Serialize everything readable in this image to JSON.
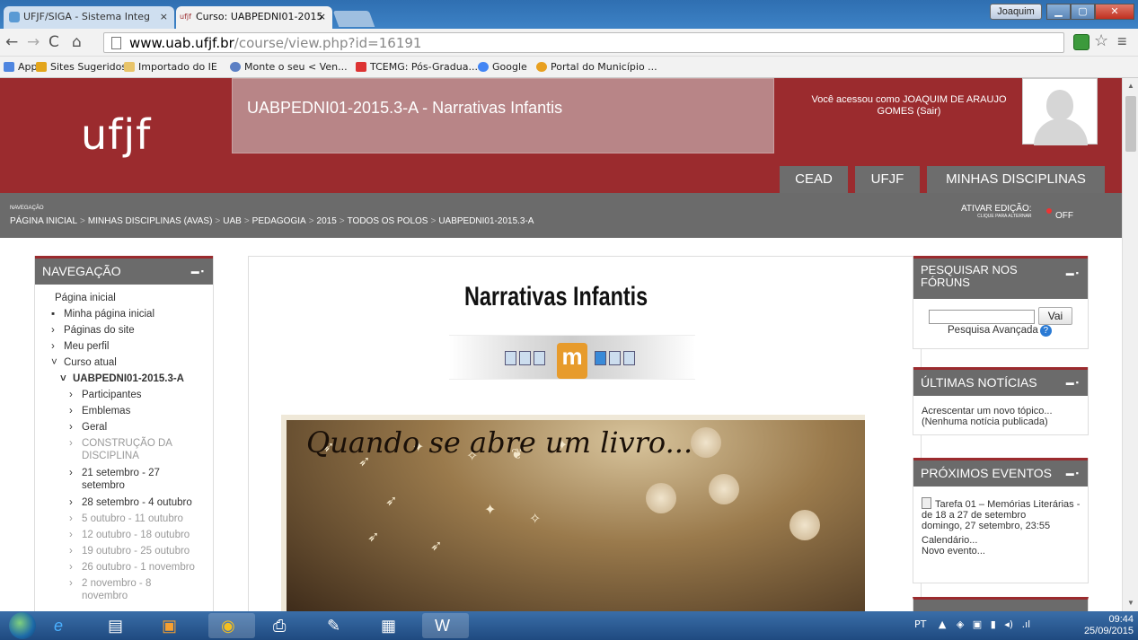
{
  "browser": {
    "tabs": [
      {
        "label": "UFJF/SIGA - Sistema Integ",
        "active": false
      },
      {
        "label": "Curso: UABPEDNI01-2015",
        "active": true
      }
    ],
    "tab_prefix_active": "ufjf",
    "user_button": "Joaquim",
    "url_host": "www.uab.ufjf.br",
    "url_path": "/course/view.php?id=16191",
    "bookmarks": [
      {
        "label": "Apps",
        "icon": "apps-grid-icon",
        "color": "#4f86e0"
      },
      {
        "label": "Sites Sugeridos",
        "icon": "bookmark-star-icon",
        "color": "#e3a51b"
      },
      {
        "label": "Importado do IE",
        "icon": "folder-icon",
        "color": "#e8c46a"
      },
      {
        "label": "Monte o seu < Ven...",
        "icon": "globe-icon",
        "color": "#5b7fc4"
      },
      {
        "label": "TCEMG: Pós-Gradua...",
        "icon": "tcemg-icon",
        "color": "#d33"
      },
      {
        "label": "Google",
        "icon": "google-icon",
        "color": "#4285f4"
      },
      {
        "label": "Portal do Município ...",
        "icon": "portal-icon",
        "color": "#e8a020"
      }
    ]
  },
  "header": {
    "logo": "ufjf",
    "course_title": "UABPEDNI01-2015.3-A - Narrativas Infantis",
    "user_info": "Você acessou como JOAQUIM DE ARAUJO GOMES (Sair)",
    "nav": [
      "CEAD",
      "UFJF",
      "MINHAS DISCIPLINAS"
    ]
  },
  "breadcrumb": {
    "label": "NAVEGAÇÃO",
    "items": [
      "PÁGINA INICIAL",
      "MINHAS DISCIPLINAS (AVAS)",
      "UAB",
      "PEDAGOGIA",
      "2015",
      "TODOS OS POLOS",
      "UABPEDNI01-2015.3-A"
    ],
    "edit_label": "ATIVAR EDIÇÃO:",
    "edit_hint": "CLIQUE PARA ALTERNAR",
    "edit_state": "OFF"
  },
  "nav_block": {
    "title": "NAVEGAÇÃO",
    "items": [
      {
        "label": "Página inicial",
        "indent": 0,
        "bullet": "",
        "muted": false,
        "bold": false
      },
      {
        "label": "Minha página inicial",
        "indent": 1,
        "bullet": "▪",
        "muted": false,
        "bold": false
      },
      {
        "label": "Páginas do site",
        "indent": 1,
        "bullet": "›",
        "muted": false,
        "bold": false
      },
      {
        "label": "Meu perfil",
        "indent": 1,
        "bullet": "›",
        "muted": false,
        "bold": false
      },
      {
        "label": "Curso atual",
        "indent": 1,
        "bullet": "˅",
        "muted": false,
        "bold": false
      },
      {
        "label": "UABPEDNI01-2015.3-A",
        "indent": 2,
        "bullet": "˅",
        "muted": false,
        "bold": true
      },
      {
        "label": "Participantes",
        "indent": 3,
        "bullet": "›",
        "muted": false,
        "bold": false
      },
      {
        "label": "Emblemas",
        "indent": 3,
        "bullet": "›",
        "muted": false,
        "bold": false
      },
      {
        "label": "Geral",
        "indent": 3,
        "bullet": "›",
        "muted": false,
        "bold": false
      },
      {
        "label": "CONSTRUÇÃO DA",
        "indent": 3,
        "bullet": "›",
        "muted": true,
        "bold": false
      },
      {
        "label": "DISCIPLINA",
        "indent": 3,
        "bullet": "",
        "muted": true,
        "bold": false
      },
      {
        "label": "21 setembro - 27",
        "indent": 3,
        "bullet": "›",
        "muted": false,
        "bold": false
      },
      {
        "label": "setembro",
        "indent": 3,
        "bullet": "",
        "muted": false,
        "bold": false
      },
      {
        "label": "28 setembro - 4 outubro",
        "indent": 3,
        "bullet": "›",
        "muted": false,
        "bold": false
      },
      {
        "label": "5 outubro - 11 outubro",
        "indent": 3,
        "bullet": "›",
        "muted": true,
        "bold": false
      },
      {
        "label": "12 outubro - 18 outubro",
        "indent": 3,
        "bullet": "›",
        "muted": true,
        "bold": false
      },
      {
        "label": "19 outubro - 25 outubro",
        "indent": 3,
        "bullet": "›",
        "muted": true,
        "bold": false
      },
      {
        "label": "26 outubro - 1 novembro",
        "indent": 3,
        "bullet": "›",
        "muted": true,
        "bold": false
      },
      {
        "label": "2 novembro - 8",
        "indent": 3,
        "bullet": "›",
        "muted": true,
        "bold": false
      },
      {
        "label": "novembro",
        "indent": 3,
        "bullet": "",
        "muted": true,
        "bold": false
      }
    ]
  },
  "main": {
    "heading": "Narrativas Infantis",
    "hero_text": "Quando se abre um livro..."
  },
  "search_block": {
    "title": "PESQUISAR NOS FÓRUNS",
    "value": "",
    "button": "Vai",
    "advanced": "Pesquisa Avançada"
  },
  "news_block": {
    "title": "ÚLTIMAS NOTÍCIAS",
    "add_link": "Acrescentar um novo tópico...",
    "empty": "(Nenhuma notícia publicada)"
  },
  "events_block": {
    "title": "PRÓXIMOS EVENTOS",
    "event_title": "Tarefa 01 – Memórias Literárias - de 18 a 27 de setembro",
    "event_date": "domingo, 27 setembro, 23:55",
    "calendar_link": "Calendário...",
    "new_event_link": "Novo evento..."
  },
  "taskbar": {
    "lang": "PT",
    "time": "09:44",
    "date": "25/09/2015"
  }
}
